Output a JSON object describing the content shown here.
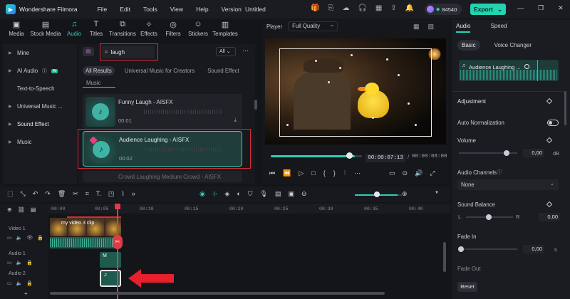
{
  "app": {
    "name": "Wondershare Filmora",
    "project_title": "Untitled",
    "credits": "84540",
    "export_label": "Export",
    "menu": [
      "File",
      "Edit",
      "Tools",
      "View",
      "Help",
      "Version"
    ]
  },
  "toolbar_tabs": [
    {
      "label": "Media",
      "icon": "media-icon"
    },
    {
      "label": "Stock Media",
      "icon": "stock-media-icon"
    },
    {
      "label": "Audio",
      "icon": "audio-icon"
    },
    {
      "label": "Titles",
      "icon": "titles-icon"
    },
    {
      "label": "Transitions",
      "icon": "transitions-icon"
    },
    {
      "label": "Effects",
      "icon": "effects-icon"
    },
    {
      "label": "Filters",
      "icon": "filters-icon"
    },
    {
      "label": "Stickers",
      "icon": "stickers-icon"
    },
    {
      "label": "Templates",
      "icon": "templates-icon"
    }
  ],
  "sidebar": {
    "items": [
      {
        "label": "Mine"
      },
      {
        "label": "AI Audio"
      },
      {
        "label": "Text-to-Speech"
      },
      {
        "label": "Universal Music ..."
      },
      {
        "label": "Sound Effect"
      },
      {
        "label": "Music"
      }
    ],
    "ai_badge": "AI"
  },
  "search": {
    "value": "laugh",
    "scope": "All"
  },
  "filters": [
    "All Results",
    "Universal Music for Creators",
    "Sound Effect"
  ],
  "section_label": "Music",
  "results": [
    {
      "name": "Funny Laugh - AISFX",
      "duration": "00:01"
    },
    {
      "name": "Audience Laughing - AISFX",
      "duration": "00:02"
    },
    {
      "name": "Crowd Laughing Medium Crowd - AISFX",
      "duration": ""
    }
  ],
  "player": {
    "label": "Player",
    "quality": "Full Quality",
    "current_time": "00:00:07:13",
    "total_time": "00:00:08:00",
    "progress": 0.93
  },
  "right_panel": {
    "tabs": [
      "Audio",
      "Speed"
    ],
    "subtabs": [
      "Basic",
      "Voice Changer"
    ],
    "clip_name": "Audience Laughing ...",
    "adjustment_label": "Adjustment",
    "auto_norm_label": "Auto Normalization",
    "volume_label": "Volume",
    "volume_value": "0,00",
    "volume_unit": "dB",
    "channels_label": "Audio Channels",
    "channels_value": "None",
    "balance_label": "Sound Balance",
    "balance_l": "L",
    "balance_r": "R",
    "balance_value": "0,00",
    "fadein_label": "Fade In",
    "fadein_value": "0,00",
    "fadein_unit": "s",
    "fadeout_label": "Fade Out",
    "reset_label": "Reset"
  },
  "timeline": {
    "ruler": [
      "00:00",
      "00:05",
      "00:10",
      "00:15",
      "00:20",
      "00:25",
      "00:30",
      "00:35",
      "00:40"
    ],
    "tracks": [
      "Video 1",
      "Audio 1",
      "Audio 2"
    ],
    "video_clip_label": "my video 3 clip",
    "audio1_clip_label": "M",
    "zoom_level": 0.58
  }
}
